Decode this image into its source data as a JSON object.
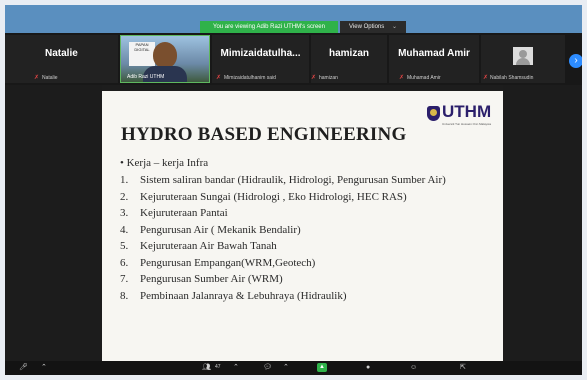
{
  "banner": {
    "viewing_text": "You are viewing Adib Razi UTHM's screen",
    "view_options_label": "View Options",
    "view_options_caret": "⌄"
  },
  "participants": [
    {
      "display": "Natalie",
      "name": "Natalie"
    },
    {
      "display": "",
      "name": "Adib Razi UTHM"
    },
    {
      "display": "Mimizaidatulha...",
      "name": "Mimizaidatulhanim said"
    },
    {
      "display": "hamizan",
      "name": "hamizan"
    },
    {
      "display": "Muhamad Amir",
      "name": "Muhamad Amir"
    },
    {
      "display": "",
      "name": "Nabilah Shamsudin"
    }
  ],
  "poster_text": "PAPAN DIGITAL",
  "slide": {
    "title": "HYDRO BASED ENGINEERING",
    "logo": "UTHM",
    "logo_sub": "Universiti Tun Hussein Onn Malaysia",
    "bullet": "• Kerja – kerja Infra",
    "items": [
      {
        "num": "1.",
        "text": "Sistem saliran bandar (Hidraulik, Hidrologi, Pengurusan Sumber Air)"
      },
      {
        "num": "2.",
        "text": "Kejuruteraan Sungai (Hidrologi , Eko Hidrologi, HEC RAS)"
      },
      {
        "num": "3.",
        "text": "Kejuruteraan Pantai"
      },
      {
        "num": "4.",
        "text": "Pengurusan Air ( Mekanik Bendalir)"
      },
      {
        "num": "5.",
        "text": "Kejuruteraan Air Bawah Tanah"
      },
      {
        "num": "6.",
        "text": "Pengurusan Empangan(WRM,Geotech)"
      },
      {
        "num": "7.",
        "text": "Pengurusan Sumber Air (WRM)"
      },
      {
        "num": "8.",
        "text": "Pembinaan Jalanraya & Lebuhraya (Hidraulik)"
      }
    ]
  },
  "toolbar": {
    "participants_count": "47",
    "caret": "⌃",
    "icons": [
      "mute-icon",
      "participants-icon",
      "chat-icon",
      "share-screen-icon",
      "record-icon",
      "reactions-icon",
      "leave-icon"
    ]
  }
}
